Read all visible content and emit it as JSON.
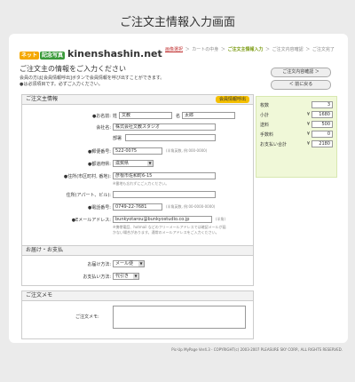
{
  "page_title": "ご注文主情報入力画面",
  "logo": {
    "tag1": "ネット",
    "tag2": "記念写真",
    "name": "kinenshashin.net"
  },
  "steps": [
    {
      "label": "画像選択",
      "state": "done"
    },
    {
      "label": "カートの中身",
      "state": "normal"
    },
    {
      "label": "ご注文主情報入力",
      "state": "current"
    },
    {
      "label": "ご注文内容確認",
      "state": "normal"
    },
    {
      "label": "ご注文完了",
      "state": "normal"
    }
  ],
  "step_arrow": "＞",
  "intro": {
    "heading": "ご注文主の情報をご入力ください",
    "line1": "会員の方は[会員情報呼出]ボタンで会員情報を呼び出すことができます。",
    "line2": "●は必須項目です。必ずご入力ください。"
  },
  "buttons": {
    "confirm": "ご注文内容確認 ＞",
    "back": "＜ 前に戻る",
    "member_call": "会員情報呼出"
  },
  "summary": {
    "rows": [
      {
        "label": "枚数",
        "yen": "",
        "value": "3"
      },
      {
        "label": "小計",
        "yen": "¥",
        "value": "1680"
      },
      {
        "label": "送料",
        "yen": "¥",
        "value": "500"
      },
      {
        "label": "手数料",
        "yen": "¥",
        "value": "0"
      },
      {
        "label": "お支払い合計",
        "yen": "¥",
        "value": "2180"
      }
    ]
  },
  "orderer": {
    "title": "ご注文主情報",
    "name_label": "●お名前:",
    "sei_label": "姓",
    "sei": "文教",
    "mei_label": "名",
    "mei": "太郎",
    "company_label": "会社名:",
    "company": "株式会社文教スタジオ",
    "dept_label": "部署",
    "dept": "",
    "zip_label": "●郵便番号:",
    "zip": "522-0075",
    "zip_note": "(半角英数, 例:000-0000)",
    "pref_label": "●都道府県:",
    "pref": "滋賀県",
    "addr_label": "●住所(市区町村, 番地):",
    "addr": "彦根市佐和町6-15",
    "addr_note": "※番地も忘れずにご入力ください。",
    "addr2_label": "住所(アパート、ビル):",
    "addr2": "",
    "tel_label": "●電話番号:",
    "tel": "0749-22-7681",
    "tel_note": "(半角英数, 例:00-0000-0000)",
    "email_label": "●Eメールアドレス:",
    "email": "bunkyotarou@bunkyostudio.co.jp",
    "email_note": "(半角)",
    "email_note2": "※携帯電話、hotmail などのフリーメールアドレスでは確認メールが届",
    "email_note3": "かない場合があります。通常のメールアドレスをご入力ください。"
  },
  "delivery": {
    "title": "お届け・お支払",
    "method_label": "お届け方法:",
    "method": "メール便",
    "pay_label": "お支払い方法:",
    "pay": "代引き"
  },
  "memo": {
    "title": "ご注文メモ",
    "label": "ご注文メモ:",
    "value": ""
  },
  "footer": "Pic-Up MyPage Ver4.3 - COPYRIGHT(c) 2003-2007 PLEASURE SKY CORP., ALL RIGHTS RESERVED."
}
